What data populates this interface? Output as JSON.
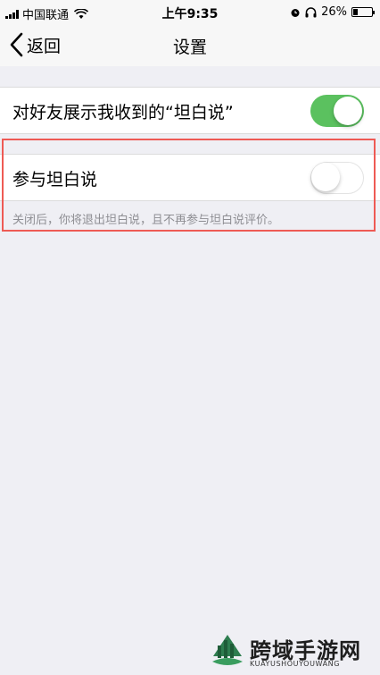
{
  "status_bar": {
    "carrier": "中国联通",
    "time": "上午9:35",
    "battery_percent": "26%",
    "battery_level": 0.26,
    "icons": [
      "signal-icon",
      "wifi-icon",
      "alarm-icon",
      "headphones-icon",
      "battery-icon"
    ]
  },
  "nav": {
    "back_label": "返回",
    "title": "设置"
  },
  "settings": {
    "show_to_friends": {
      "label": "对好友展示我收到的“坦白说”",
      "on": true
    },
    "participate": {
      "label": "参与坦白说",
      "on": false
    },
    "hint": "关闭后，你将退出坦白说，且不再参与坦白说评价。"
  },
  "colors": {
    "toggle_on": "#5bc15f",
    "highlight_border": "#ee5a54",
    "background": "#efeff4"
  },
  "watermark": {
    "name": "跨域手游网",
    "sub": "KUAYUSHOUYOUWANG"
  }
}
